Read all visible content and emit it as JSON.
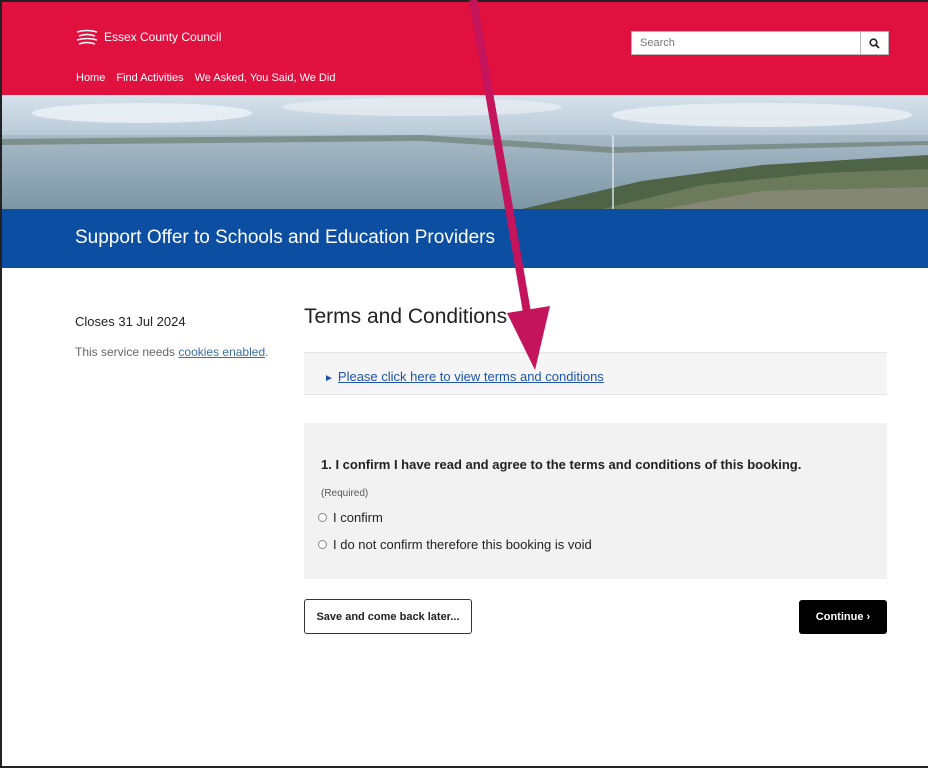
{
  "header": {
    "logo_text": "Essex County Council",
    "nav": [
      "Home",
      "Find Activities",
      "We Asked, You Said, We Did"
    ],
    "search_placeholder": "Search"
  },
  "banner": {
    "title": "Support Offer to Schools and Education Providers"
  },
  "sidebar": {
    "closes": "Closes 31 Jul 2024",
    "cookies_prefix": "This service needs ",
    "cookies_link": "cookies enabled",
    "cookies_suffix": "."
  },
  "main": {
    "page_title": "Terms and Conditions",
    "terms_link": "Please click here to view terms and conditions",
    "question": {
      "label": "1. I confirm I have read and agree to the terms and conditions of this booking.",
      "required": "(Required)",
      "options": [
        "I confirm",
        "I do not confirm therefore this booking is void"
      ]
    },
    "save_button": "Save and come back later...",
    "continue_button": "Continue"
  },
  "colors": {
    "header_red": "#e0103f",
    "title_blue": "#0b4ea2",
    "annotation_arrow": "#c4145c"
  }
}
